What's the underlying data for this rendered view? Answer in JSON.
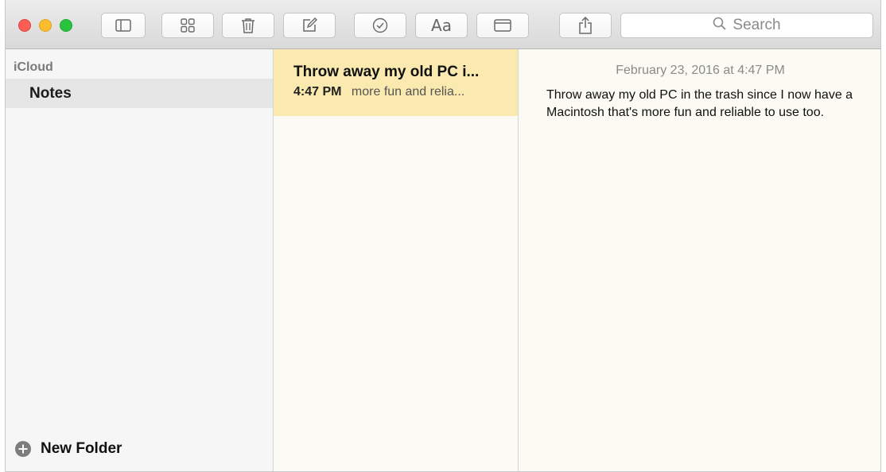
{
  "toolbar": {
    "buttons": [
      {
        "name": "toggle-sidebar-button",
        "icon": "sidebar-icon"
      },
      {
        "name": "attachments-browser-button",
        "icon": "grid-icon"
      },
      {
        "name": "delete-note-button",
        "icon": "trash-icon"
      },
      {
        "name": "new-note-button",
        "icon": "compose-icon"
      },
      {
        "name": "checklist-button",
        "icon": "checkmark-circle-icon"
      },
      {
        "name": "format-button",
        "icon": "text-style-icon",
        "label": "Aa"
      },
      {
        "name": "add-table-button",
        "icon": "window-icon"
      },
      {
        "name": "share-button",
        "icon": "share-icon"
      }
    ],
    "search_placeholder": "Search"
  },
  "sidebar": {
    "section": "iCloud",
    "items": [
      {
        "label": "Notes",
        "selected": true
      }
    ],
    "new_folder_label": "New Folder"
  },
  "note_list": {
    "items": [
      {
        "title": "Throw away my old PC i...",
        "time": "4:47 PM",
        "preview": "more fun and relia...",
        "selected": true
      }
    ]
  },
  "editor": {
    "date": "February 23, 2016 at 4:47 PM",
    "body": "Throw away my old PC in the trash since I now have a Macintosh that's more fun and reliable to use too."
  },
  "colors": {
    "close": "#fc5d57",
    "minimize": "#fdbc2e",
    "zoom": "#29c33f",
    "selected_note": "#faeab0",
    "sidebar_selected": "#e6e6e6"
  }
}
